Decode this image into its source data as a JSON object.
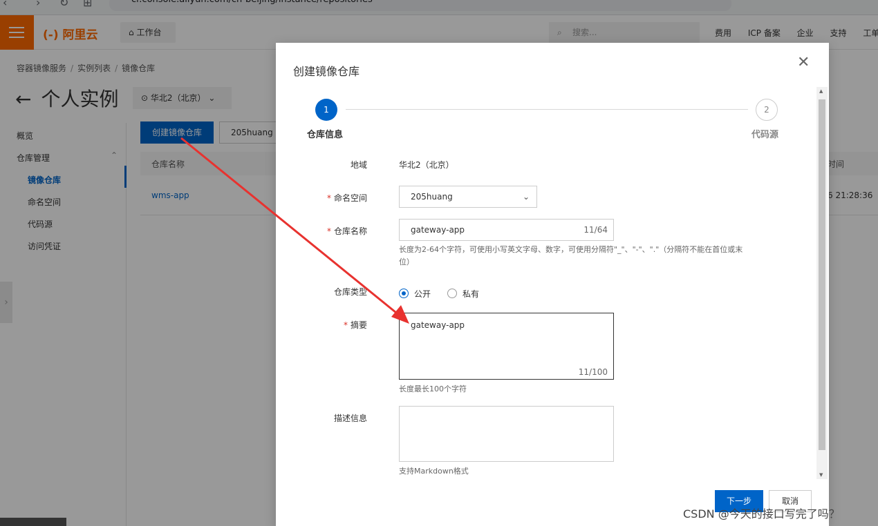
{
  "browser": {
    "url": "cr.console.aliyun.com/cn-beijing/instance/repositories"
  },
  "topbar": {
    "logo": "阿里云",
    "workbench": "工作台",
    "search_placeholder": "搜索...",
    "links": [
      "费用",
      "ICP 备案",
      "企业",
      "支持",
      "工单"
    ]
  },
  "breadcrumb": [
    "容器镜像服务",
    "实例列表",
    "镜像仓库"
  ],
  "page": {
    "title": "个人实例",
    "region": "华北2（北京）"
  },
  "sidebar": {
    "items": [
      "概览",
      "仓库管理",
      "镜像仓库",
      "命名空间",
      "代码源",
      "访问凭证"
    ]
  },
  "list": {
    "create_button": "创建镜像仓库",
    "namespace_filter": "205huang",
    "col_name": "仓库名称",
    "col_time": "时间",
    "rows": [
      {
        "name": "wms-app",
        "time": "6 21:28:36"
      }
    ]
  },
  "modal": {
    "title": "创建镜像仓库",
    "steps": [
      {
        "num": "1",
        "label": "仓库信息"
      },
      {
        "num": "2",
        "label": "代码源"
      }
    ],
    "region_label": "地域",
    "region_value": "华北2（北京）",
    "namespace_label": "命名空间",
    "namespace_value": "205huang",
    "repo_name_label": "仓库名称",
    "repo_name_value": "gateway-app",
    "repo_name_counter": "11/64",
    "repo_name_hint": "长度为2-64个字符，可使用小写英文字母、数字，可使用分隔符\"_\"、\"-\"、\".\"（分隔符不能在首位或末位）",
    "repo_type_label": "仓库类型",
    "repo_type_options": [
      "公开",
      "私有"
    ],
    "repo_type_selected": "公开",
    "summary_label": "摘要",
    "summary_value": "gateway-app",
    "summary_counter": "11/100",
    "summary_hint": "长度最长100个字符",
    "description_label": "描述信息",
    "description_hint": "支持Markdown格式",
    "next_button": "下一步",
    "cancel_button": "取消"
  },
  "watermark": "CSDN @今天的接口写完了吗？",
  "colors": {
    "brand_orange": "#ff6a00",
    "primary_blue": "#0064c8",
    "required_red": "#d93026",
    "annotation_red": "#e8322f"
  }
}
